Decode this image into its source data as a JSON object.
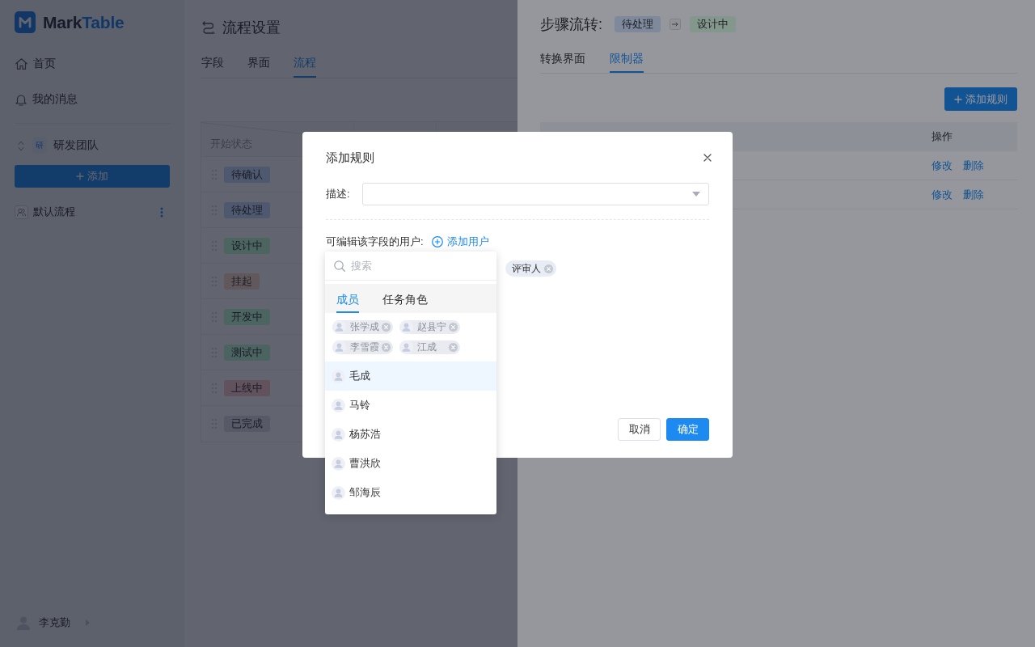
{
  "sidebar": {
    "logo": {
      "text_parts": [
        "Mark",
        "Table"
      ]
    },
    "nav": [
      {
        "kind": "home",
        "label": "首页"
      },
      {
        "kind": "messages",
        "label": "我的消息"
      }
    ],
    "team": {
      "badge": "研",
      "name": "研发团队"
    },
    "add_button": "添加",
    "workflows": [
      {
        "name": "默认流程"
      }
    ],
    "user": {
      "name": "李克勤"
    }
  },
  "main": {
    "title": "流程设置",
    "tabs": [
      {
        "label": "字段",
        "selected": false
      },
      {
        "label": "界面",
        "selected": false
      },
      {
        "label": "流程",
        "selected": true
      }
    ],
    "table": {
      "corner_header": "开始状态",
      "rows": [
        {
          "status": "待确认",
          "color": "#4e586e"
        },
        {
          "status": "待处理",
          "color": "#4e586e"
        },
        {
          "status": "设计中",
          "color": "#4d6560"
        },
        {
          "status": "挂起",
          "color": "#60585a"
        },
        {
          "status": "开发中",
          "color": "#4d6560"
        },
        {
          "status": "测试中",
          "color": "#4c6462"
        },
        {
          "status": "上线中",
          "color": "#62525e"
        },
        {
          "status": "已完成",
          "color": "#575b66"
        }
      ]
    }
  },
  "drawer": {
    "title": "步骤流转:",
    "transition": [
      {
        "label": "待处理",
        "color": "#7e8a9c"
      },
      {
        "label": "设计中",
        "color": "#84978c"
      }
    ],
    "tabs": [
      {
        "label": "转换界面",
        "selected": false
      },
      {
        "label": "限制器",
        "selected": true
      }
    ],
    "add_rule_button": "添加规则",
    "table": {
      "action_header": "操作",
      "rows": [
        {
          "actions": [
            "修改",
            "删除"
          ]
        },
        {
          "actions": [
            "修改",
            "删除"
          ]
        }
      ]
    }
  },
  "dialog": {
    "title": "添加规则",
    "description_label": "描述:",
    "editors_label": "可编辑该字段的用户:",
    "add_user_link": "添加用户",
    "editor_chips": [
      {
        "name": "评审人"
      }
    ],
    "buttons": [
      {
        "kind": "secondary",
        "label": "取消"
      },
      {
        "kind": "primary",
        "label": "确定"
      }
    ]
  },
  "user_picker": {
    "search": {
      "placeholder": "搜索"
    },
    "tabs": [
      {
        "label": "成员",
        "selected": true
      },
      {
        "label": "任务角色",
        "selected": false
      }
    ],
    "selected_members": [
      {
        "name": "张学成"
      },
      {
        "name": "赵县宁"
      },
      {
        "name": "李雪霞"
      },
      {
        "name": "江成"
      }
    ],
    "members": [
      {
        "name": "毛成",
        "highlighted": true
      },
      {
        "name": "马铃",
        "highlighted": false
      },
      {
        "name": "杨苏浩",
        "highlighted": false
      },
      {
        "name": "曹洪欣",
        "highlighted": false
      },
      {
        "name": "邹海辰",
        "highlighted": false
      }
    ]
  }
}
